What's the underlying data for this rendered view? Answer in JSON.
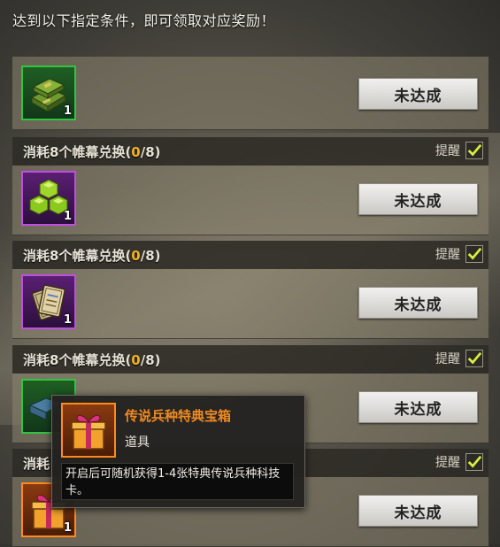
{
  "header": "达到以下指定条件，即可领取对应奖励！",
  "remind_label": "提醒",
  "button_label": "未达成",
  "rows": [
    {
      "title_prefix": "",
      "count": "",
      "title_suffix": "",
      "qty": "1",
      "icon": "supply-crate-icon",
      "rarity": "green"
    },
    {
      "title_prefix": "消耗8个帷幕兑换(",
      "count": "0",
      "title_suffix": "/8)",
      "qty": "1",
      "icon": "green-gems-icon",
      "rarity": "purple"
    },
    {
      "title_prefix": "消耗8个帷幕兑换(",
      "count": "0",
      "title_suffix": "/8)",
      "qty": "1",
      "icon": "tech-cards-icon",
      "rarity": "purple"
    },
    {
      "title_prefix": "消耗8个帷幕兑换(",
      "count": "0",
      "title_suffix": "/8)",
      "qty": "",
      "icon": "supply-crate-icon",
      "rarity": "green"
    },
    {
      "title_prefix": "消耗",
      "count": "",
      "title_suffix": "",
      "qty": "1",
      "icon": "gift-box-icon",
      "rarity": "orange"
    }
  ],
  "tooltip": {
    "name": "传说兵种特典宝箱",
    "type": "道具",
    "description": "开启后可随机获得1-4张特典传说兵种科技卡。",
    "icon": "gift-box-icon"
  },
  "colors": {
    "count_highlight": "#f3b21e",
    "tooltip_name": "#f08a1f",
    "rarity_green": "#31c43f",
    "rarity_purple": "#c04ee0",
    "rarity_orange": "#ff8a1c"
  }
}
